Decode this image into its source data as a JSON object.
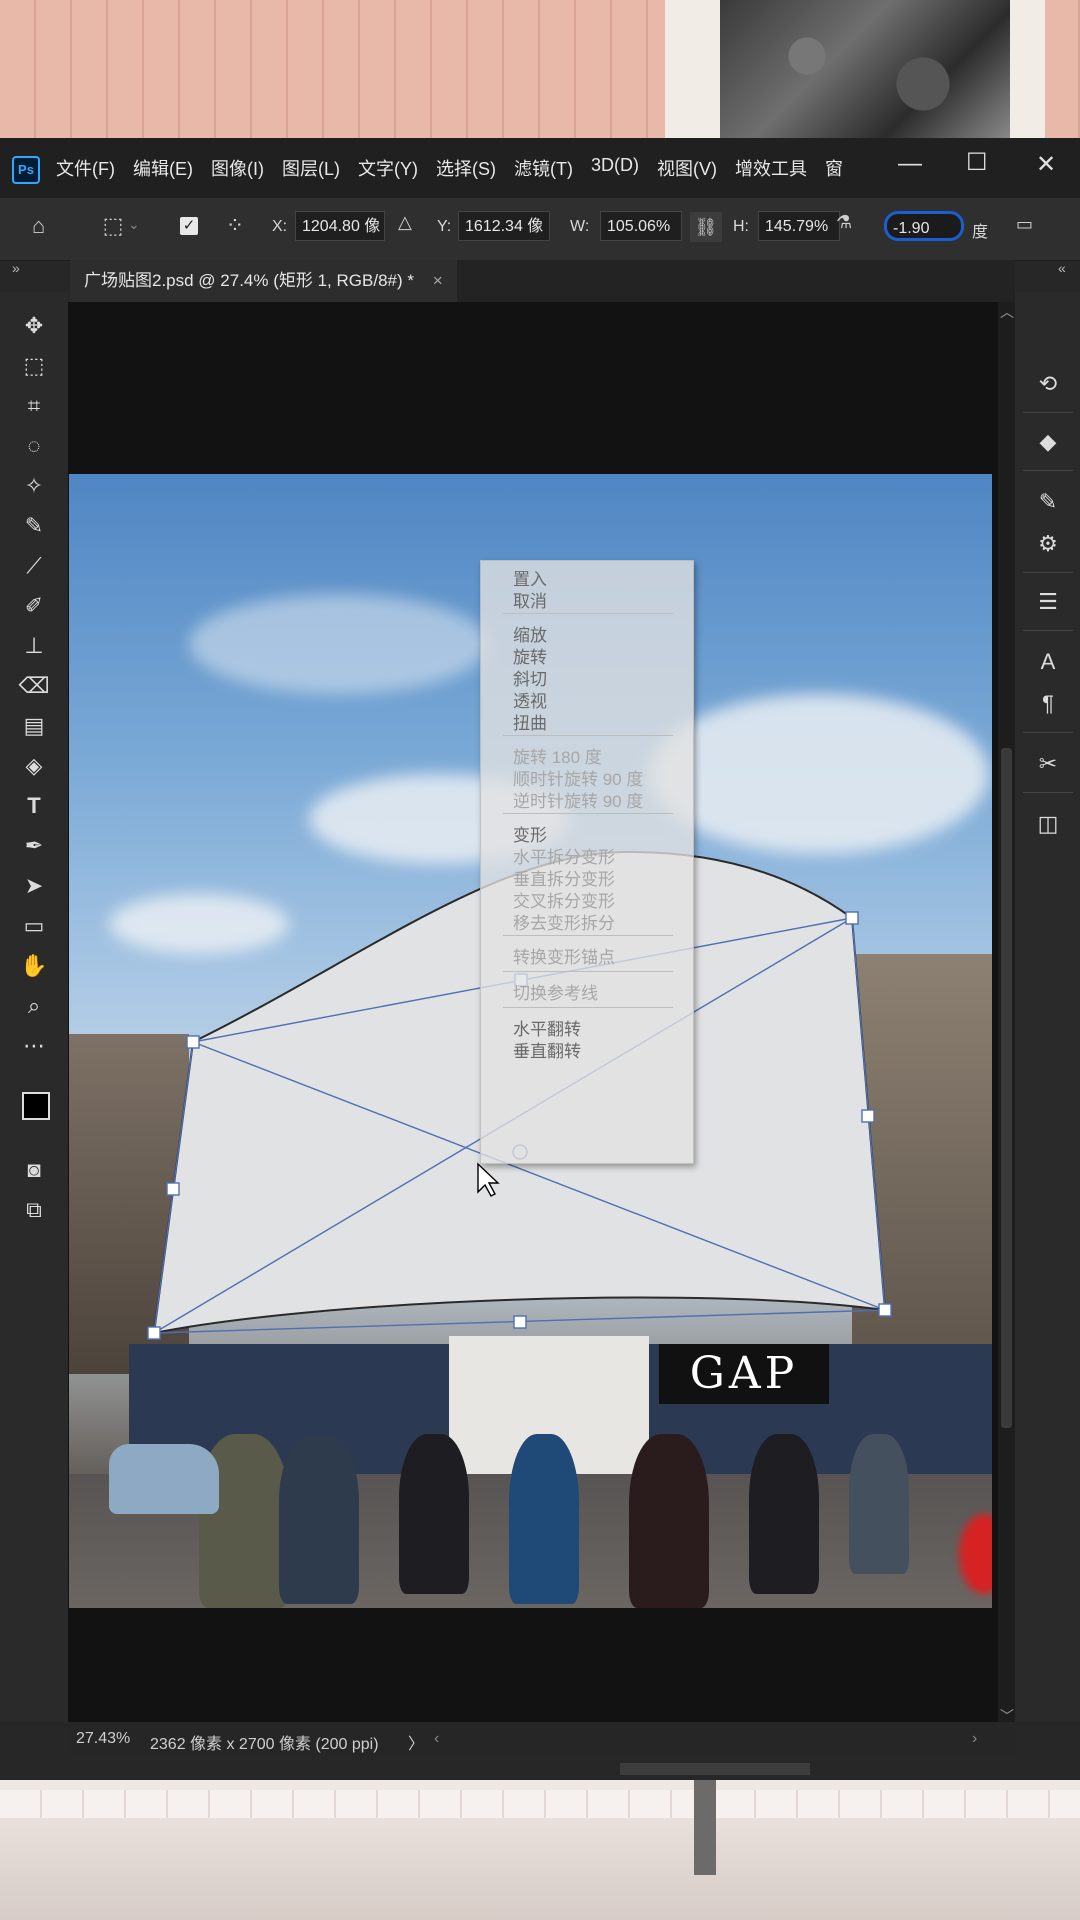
{
  "app": {
    "logo": "Ps",
    "menu": [
      "文件(F)",
      "编辑(E)",
      "图像(I)",
      "图层(L)",
      "文字(Y)",
      "选择(S)",
      "滤镜(T)",
      "3D(D)",
      "视图(V)",
      "增效工具",
      "窗"
    ],
    "window_controls": [
      "minimize",
      "maximize",
      "close"
    ]
  },
  "options_bar": {
    "x_label": "X:",
    "x_value": "1204.80 像",
    "y_label": "Y:",
    "y_value": "1612.34 像",
    "w_label": "W:",
    "w_value": "105.06%",
    "h_label": "H:",
    "h_value": "145.79%",
    "angle_value": "-1.90",
    "angle_unit": "度",
    "highlight_color": "#1a5fd1"
  },
  "document_tab": {
    "title": "广场贴图2.psd @ 27.4% (矩形 1, RGB/8#) *",
    "close": "×"
  },
  "context_menu": {
    "groups": [
      [
        "置入",
        "取消"
      ],
      [
        "缩放",
        "旋转",
        "斜切",
        "透视",
        "扭曲"
      ],
      [
        "旋转 180 度",
        "顺时针旋转 90 度",
        "逆时针旋转 90 度"
      ],
      [
        "变形",
        "水平拆分变形",
        "垂直拆分变形",
        "交叉拆分变形",
        "移去变形拆分"
      ],
      [
        "转换变形锚点"
      ],
      [
        "切换参考线"
      ],
      [
        "水平翻转",
        "垂直翻转"
      ]
    ]
  },
  "status_bar": {
    "zoom": "27.43%",
    "doc_info": "2362 像素 x 2700 像素 (200 ppi)",
    "arrow": "〉"
  },
  "photo": {
    "store_sign": "GAP"
  },
  "left_tools": [
    "move-icon",
    "marquee-icon",
    "crop-icon",
    "lasso-icon",
    "magic-wand-icon",
    "healing-icon",
    "eyedropper-icon",
    "brush-icon",
    "stamp-icon",
    "eraser-icon",
    "gradient-icon",
    "paint-bucket-icon",
    "type-icon",
    "pen-icon",
    "path-select-icon",
    "rectangle-icon",
    "hand-icon",
    "zoom-icon",
    "more-icon"
  ],
  "right_tools": [
    "history-icon",
    "layers-icon",
    "brushes-icon",
    "adjustments-icon",
    "properties-icon",
    "character-icon",
    "paragraph-icon",
    "tools-icon",
    "navigator-icon"
  ]
}
